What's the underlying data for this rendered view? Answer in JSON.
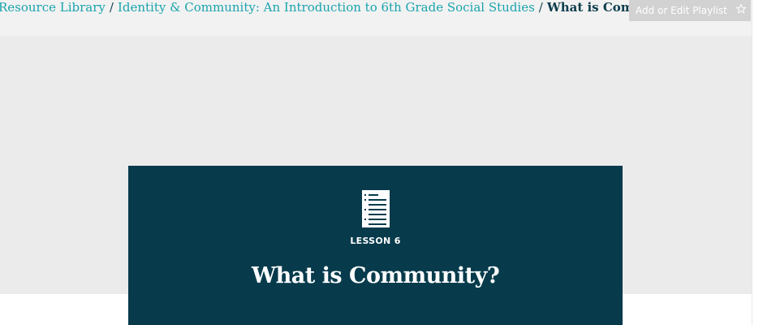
{
  "breadcrumb": {
    "items": [
      {
        "label": "Resource Library"
      },
      {
        "label": "Identity & Community: An Introduction to 6th Grade Social Studies"
      }
    ],
    "separator": "/",
    "current": "What is Community?",
    "current_icon": "check-circle-icon"
  },
  "playlist": {
    "label": "Add or Edit Playlist",
    "icon": "star-icon"
  },
  "lesson": {
    "icon": "document-icon",
    "label": "LESSON 6",
    "title": "What is Community?"
  },
  "colors": {
    "accent": "#1aa3ad",
    "dark": "#073b4c",
    "hero_background": "#ebebeb"
  }
}
